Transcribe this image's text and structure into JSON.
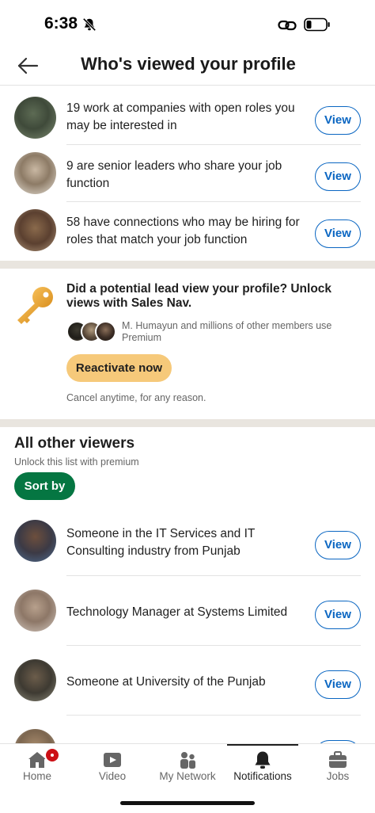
{
  "status_bar": {
    "time": "6:38"
  },
  "header": {
    "title": "Who's viewed your profile"
  },
  "summary_rows": [
    {
      "text": "19 work at companies with open roles you may be interested in",
      "button": "View"
    },
    {
      "text": "9 are senior leaders who share your job function",
      "button": "View"
    },
    {
      "text": "58 have connections who may be hiring for roles that match your job function",
      "button": "View"
    }
  ],
  "promo": {
    "title": "Did a potential lead view your profile? Unlock views with Sales Nav.",
    "members_text": "M. Humayun and millions of other members use Premium",
    "button": "Reactivate now",
    "cancel_text": "Cancel anytime, for any reason."
  },
  "other_viewers": {
    "title": "All other viewers",
    "subtitle": "Unlock this list with premium",
    "sort_button": "Sort by",
    "rows": [
      {
        "text": "Someone in the IT Services and IT Consulting industry from Punjab",
        "button": "View"
      },
      {
        "text": "Technology Manager at Systems Limited",
        "button": "View"
      },
      {
        "text": "Someone at University of the Punjab",
        "button": "View"
      }
    ]
  },
  "bottom_nav": {
    "items": [
      {
        "label": "Home",
        "icon": "home-icon",
        "badge": true
      },
      {
        "label": "Video",
        "icon": "video-icon"
      },
      {
        "label": "My Network",
        "icon": "network-icon"
      },
      {
        "label": "Notifications",
        "icon": "bell-icon",
        "active": true
      },
      {
        "label": "Jobs",
        "icon": "briefcase-icon"
      }
    ]
  },
  "colors": {
    "primary_blue": "#0a66c2",
    "green": "#057642",
    "premium_gold": "#f6c97a",
    "badge_red": "#cc1016"
  }
}
